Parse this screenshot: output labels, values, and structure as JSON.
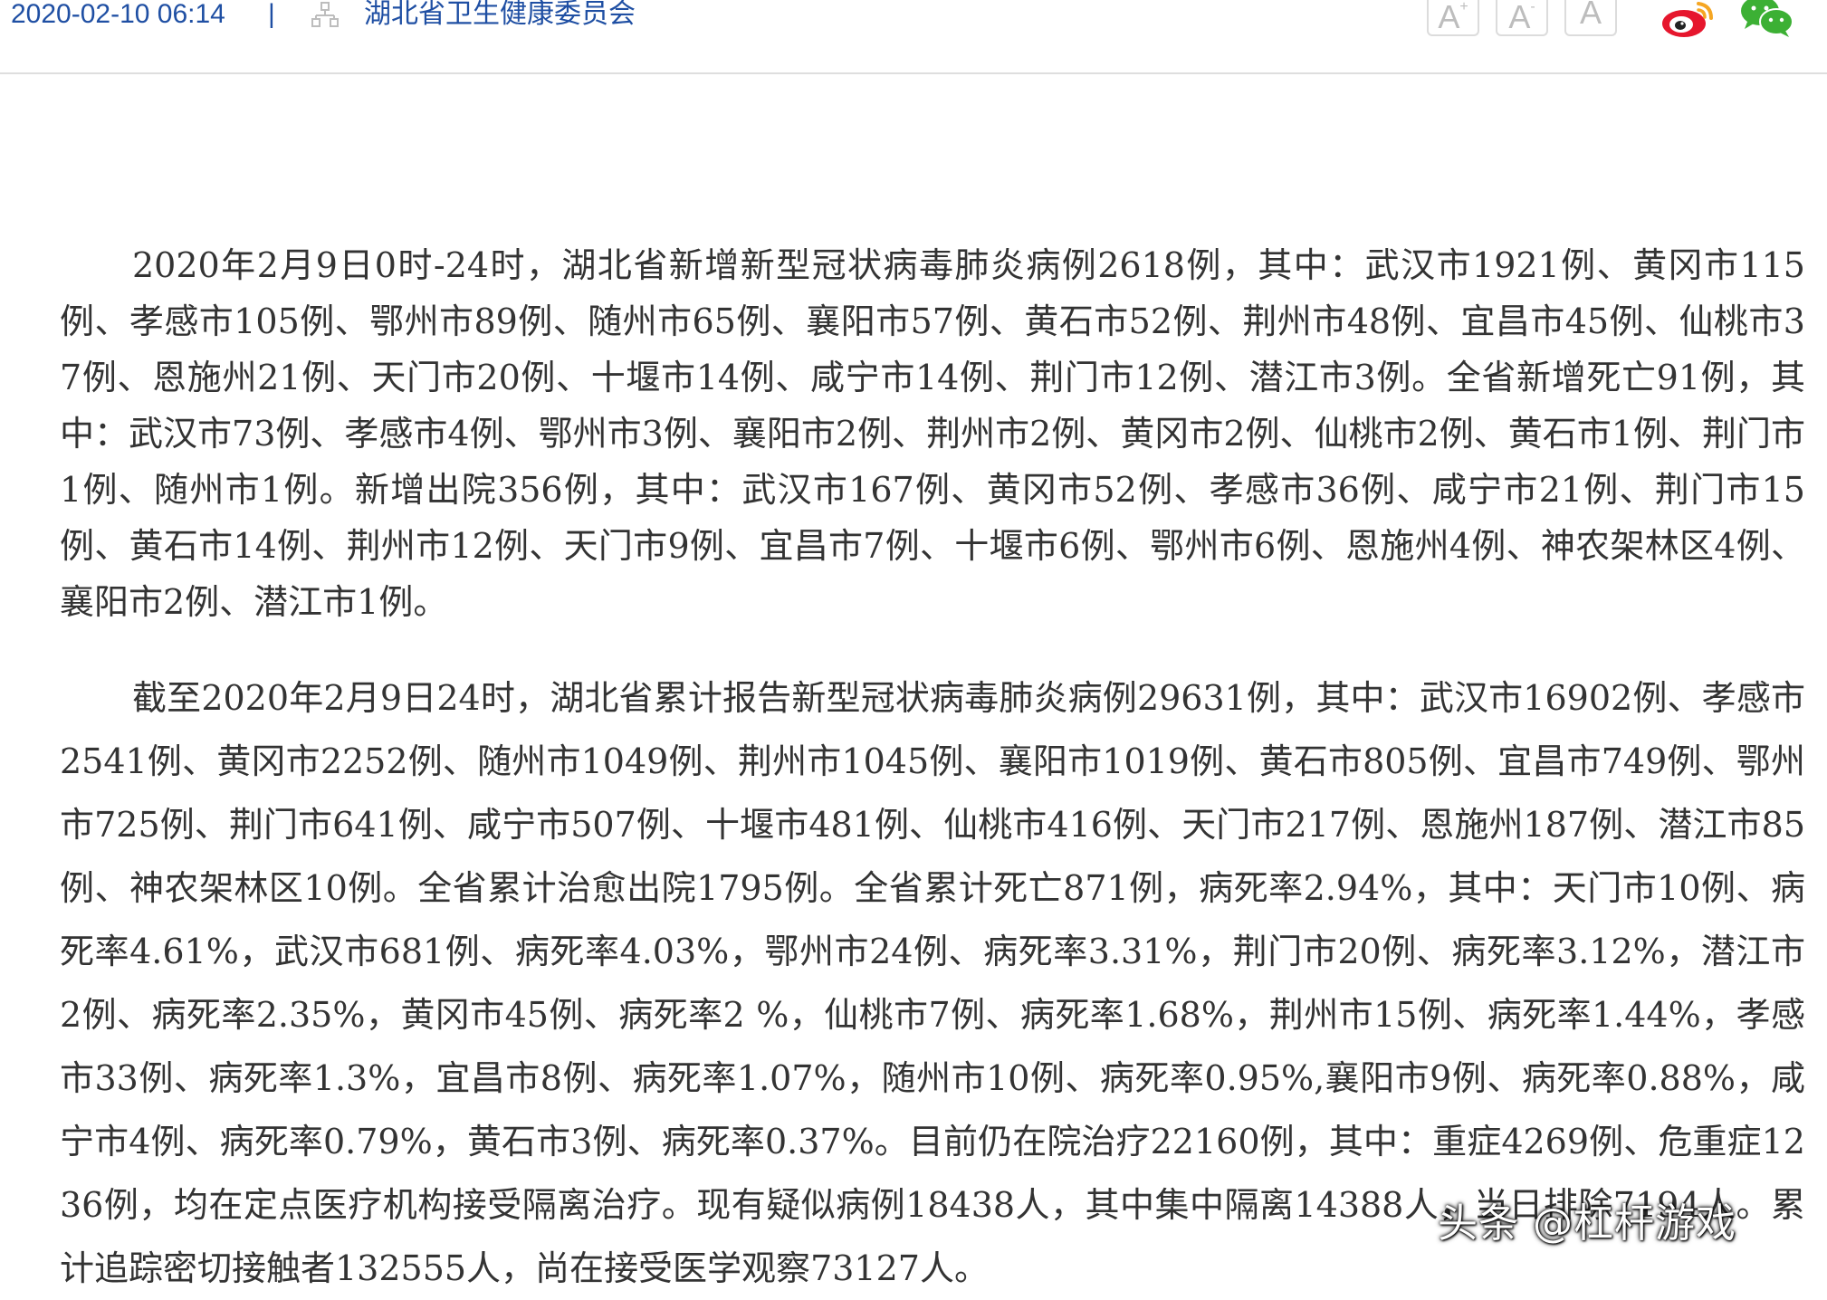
{
  "meta": {
    "date": "2020-02-10 06:14",
    "separator": "|",
    "source": "湖北省卫生健康委员会"
  },
  "font_controls": [
    {
      "label": "A",
      "mark": "+"
    },
    {
      "label": "A",
      "mark": "-"
    },
    {
      "label": "A",
      "mark": ""
    }
  ],
  "share": {
    "weibo_icon": "weibo-icon",
    "wechat_icon": "wechat-icon",
    "weibo_color": "#e6162d",
    "weibo_eye_color": "#f5a623",
    "wechat_color": "#3cb034"
  },
  "article": {
    "paragraph_1": "2020年2月9日0时-24时，湖北省新增新型冠状病毒肺炎病例2618例，其中：武汉市1921例、黄冈市115例、孝感市105例、鄂州市89例、随州市65例、襄阳市57例、黄石市52例、荆州市48例、宜昌市45例、仙桃市37例、恩施州21例、天门市20例、十堰市14例、咸宁市14例、荆门市12例、潜江市3例。全省新增死亡91例，其中：武汉市73例、孝感市4例、鄂州市3例、襄阳市2例、荆州市2例、黄冈市2例、仙桃市2例、黄石市1例、荆门市1例、随州市1例。新增出院356例，其中：武汉市167例、黄冈市52例、孝感市36例、咸宁市21例、荆门市15例、黄石市14例、荆州市12例、天门市9例、宜昌市7例、十堰市6例、鄂州市6例、恩施州4例、神农架林区4例、襄阳市2例、潜江市1例。",
    "paragraph_2": "截至2020年2月9日24时，湖北省累计报告新型冠状病毒肺炎病例29631例，其中：武汉市16902例、孝感市2541例、黄冈市2252例、随州市1049例、荆州市1045例、襄阳市1019例、黄石市805例、宜昌市749例、鄂州市725例、荆门市641例、咸宁市507例、十堰市481例、仙桃市416例、天门市217例、恩施州187例、潜江市85例、神农架林区10例。全省累计治愈出院1795例。全省累计死亡871例，病死率2.94%，其中：天门市10例、病死率4.61%，武汉市681例、病死率4.03%，鄂州市24例、病死率3.31%，荆门市20例、病死率3.12%，潜江市2例、病死率2.35%，黄冈市45例、病死率2 %，仙桃市7例、病死率1.68%，荆州市15例、病死率1.44%，孝感市33例、病死率1.3%，宜昌市8例、病死率1.07%，随州市10例、病死率0.95%,襄阳市9例、病死率0.88%，咸宁市4例、病死率0.79%，黄石市3例、病死率0.37%。目前仍在院治疗22160例，其中：重症4269例、危重症1236例，均在定点医疗机构接受隔离治疗。现有疑似病例18438人，其中集中隔离14388人，当日排除7194人。累计追踪密切接触者132555人，尚在接受医学观察73127人。"
  },
  "watermark": "头条 @杠杆游戏"
}
